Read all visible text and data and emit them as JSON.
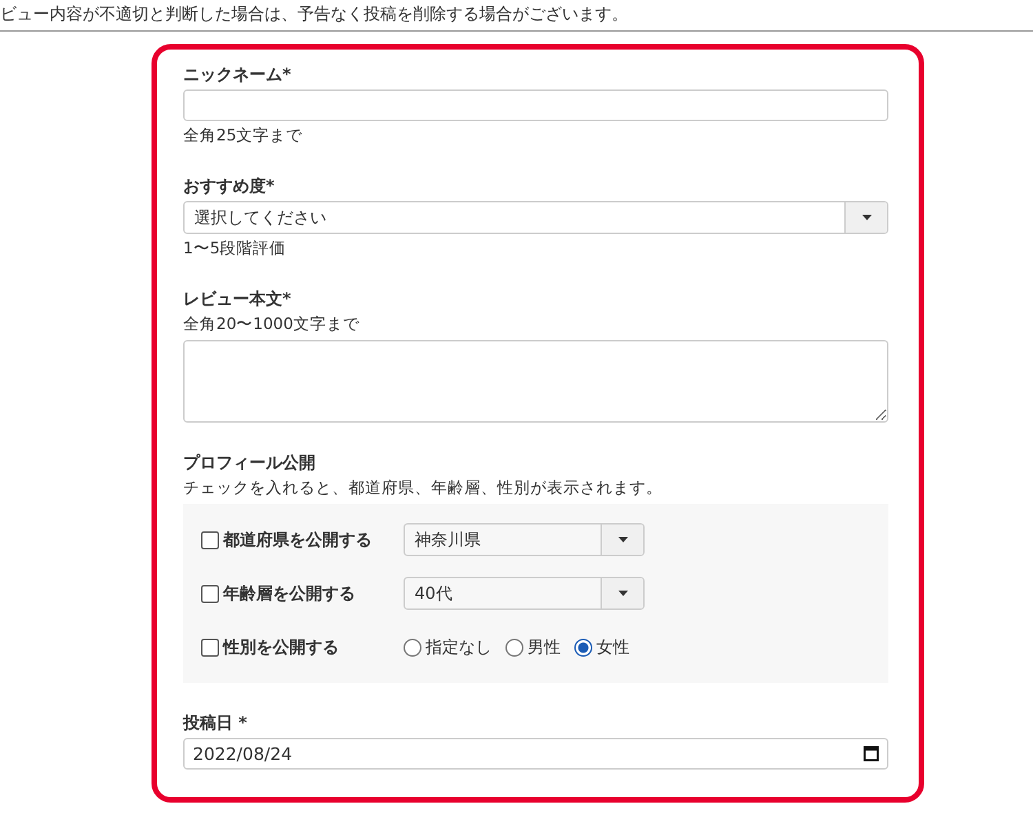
{
  "notice": "ビュー内容が不適切と判断した場合は、予告なく投稿を削除する場合がございます。",
  "nickname": {
    "label": "ニックネーム*",
    "hint": "全角25文字まで"
  },
  "rating": {
    "label": "おすすめ度*",
    "value": "選択してください",
    "hint": "1〜5段階評価"
  },
  "review": {
    "label": "レビュー本文*",
    "hint": "全角20〜1000文字まで"
  },
  "profile": {
    "label": "プロフィール公開",
    "description": "チェックを入れると、都道府県、年齢層、性別が表示されます。",
    "rows": [
      {
        "kind": "select",
        "label": "都道府県を公開する",
        "checked": false,
        "value": "神奈川県"
      },
      {
        "kind": "select",
        "label": "年齢層を公開する",
        "checked": false,
        "value": "40代"
      },
      {
        "kind": "radio",
        "label": "性別を公開する",
        "checked": false,
        "options": [
          {
            "label": "指定なし",
            "selected": false
          },
          {
            "label": "男性",
            "selected": false
          },
          {
            "label": "女性",
            "selected": true
          }
        ]
      }
    ]
  },
  "post_date": {
    "label": "投稿日 *",
    "value": "2022/08/24"
  }
}
